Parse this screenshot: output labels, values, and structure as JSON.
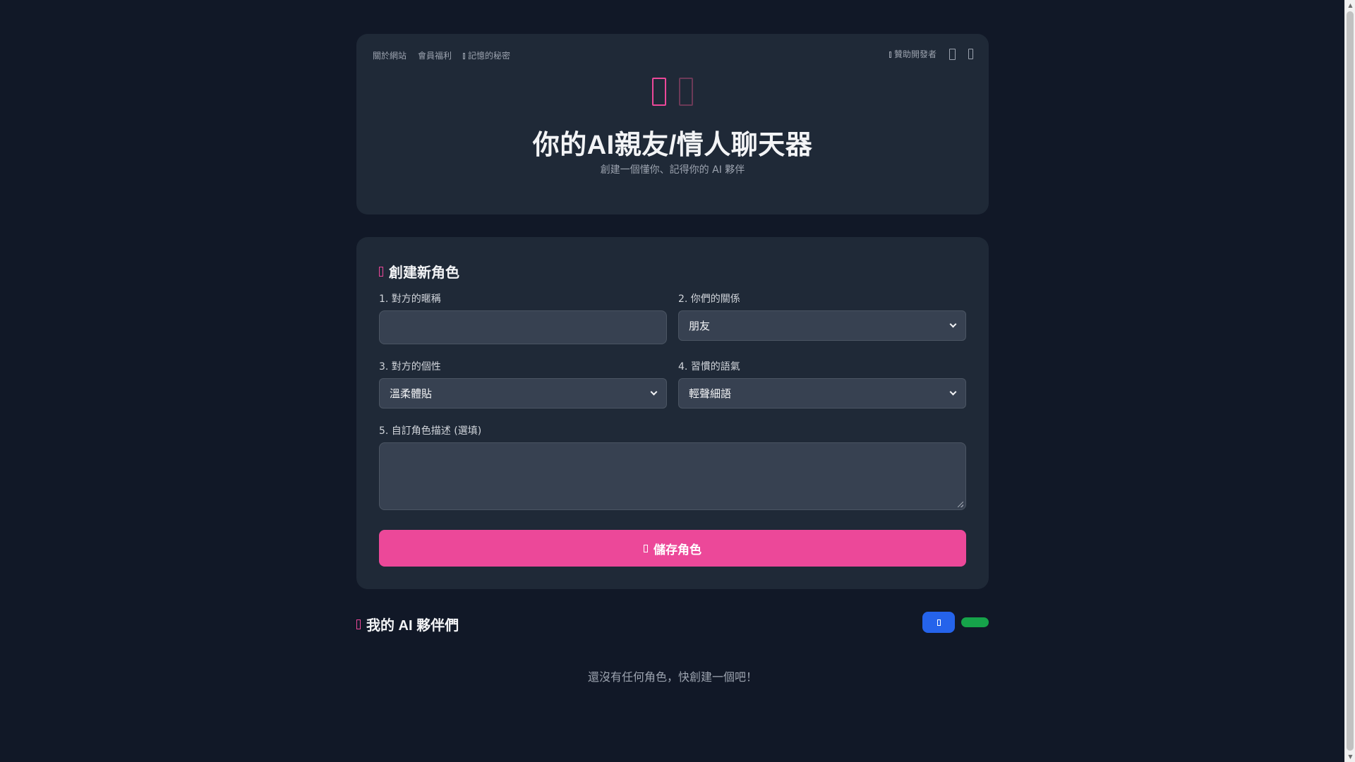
{
  "header": {
    "nav": [
      {
        "label": "關於網站"
      },
      {
        "label": "會員福利"
      },
      {
        "label": "記憶的秘密"
      }
    ],
    "sponsor_label": "贊助開發者",
    "title": "你的AI親友/情人聊天器",
    "subtitle": "創建一個懂你、記得你的 AI 夥伴"
  },
  "form": {
    "section_title": "創建新角色",
    "fields": {
      "nickname": {
        "label": "1. 對方的暱稱",
        "value": "",
        "placeholder": ""
      },
      "relationship": {
        "label": "2. 你們的關係",
        "selected": "朋友"
      },
      "personality": {
        "label": "3. 對方的個性",
        "selected": "溫柔體貼"
      },
      "tone": {
        "label": "4. 習慣的語氣",
        "selected": "輕聲細語"
      },
      "description": {
        "label": "5. 自訂角色描述 (選填)",
        "value": ""
      }
    },
    "save_label": "儲存角色"
  },
  "companions": {
    "section_title": "我的 AI 夥伴們",
    "empty_message": "還沒有任何角色，快創建一個吧！"
  },
  "colors": {
    "background": "#111827",
    "card": "#1f2937",
    "accent": "#ec4899",
    "blue": "#2563eb",
    "green": "#16a34a"
  }
}
